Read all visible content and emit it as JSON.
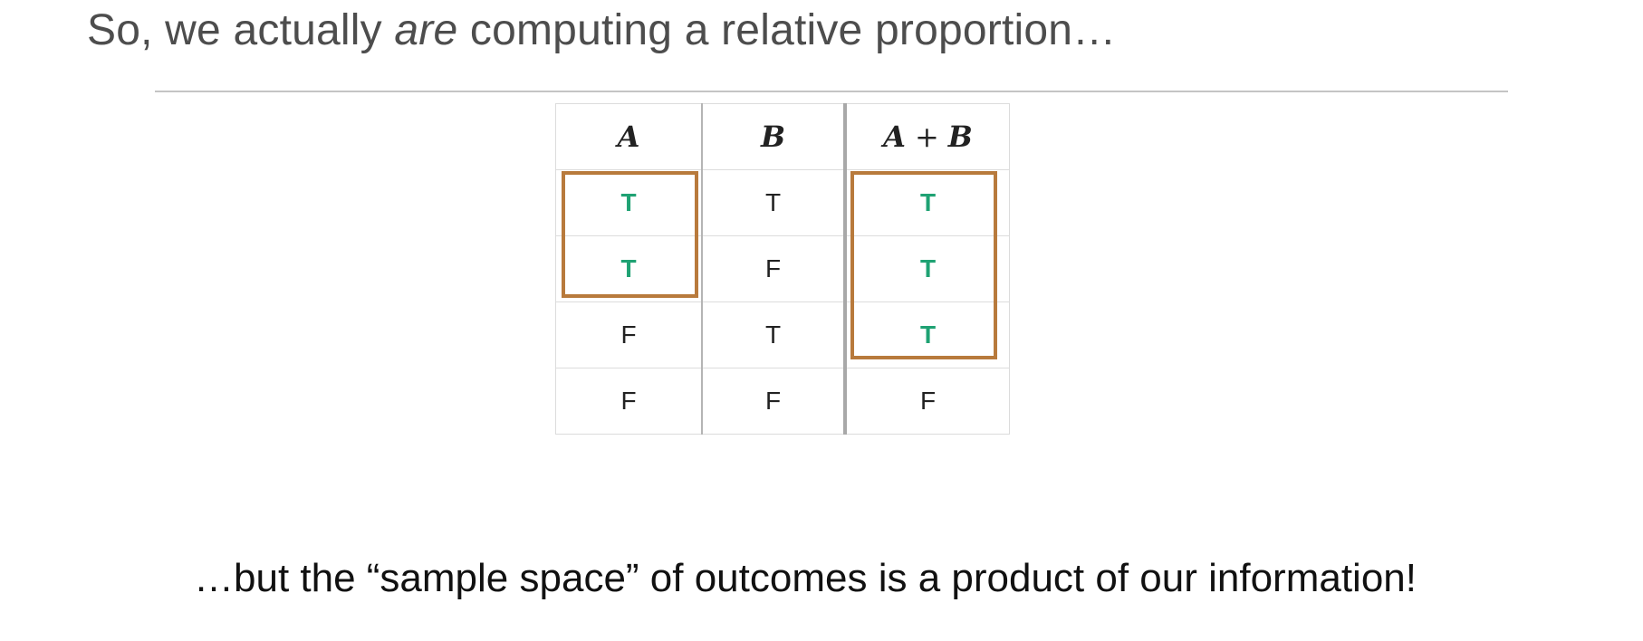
{
  "slide": {
    "title_before": "So, we actually ",
    "title_emphasis": "are",
    "title_after": " computing a relative proportion…",
    "footer": "…but the “sample space” of outcomes is a product of our information!"
  },
  "truth_table": {
    "headers": {
      "a": "A",
      "b": "B",
      "ab_left": "A",
      "ab_plus": "+",
      "ab_right": "B"
    },
    "rows": [
      {
        "a": "T",
        "b": "T",
        "ab": "T"
      },
      {
        "a": "T",
        "b": "F",
        "ab": "T"
      },
      {
        "a": "F",
        "b": "T",
        "ab": "T"
      },
      {
        "a": "F",
        "b": "F",
        "ab": "F"
      }
    ],
    "highlight_color": "#b87a3c",
    "true_highlight_color": "#1fa273",
    "header_colors": {
      "a": "#e03a2e",
      "b": "#5b9ee0",
      "ab": "#9b4fe0"
    }
  }
}
